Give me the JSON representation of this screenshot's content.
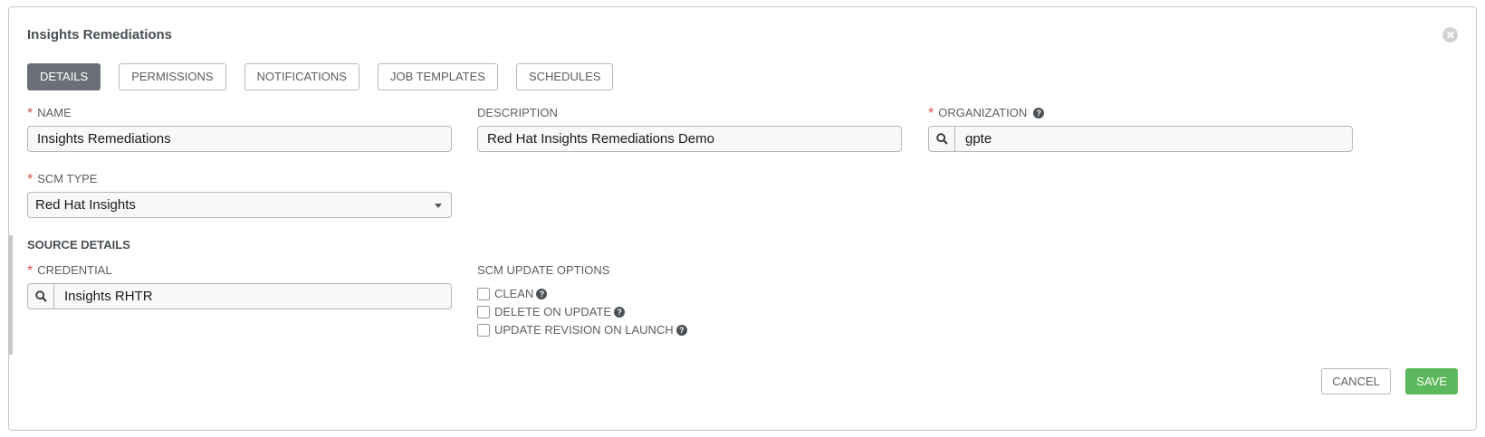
{
  "dialog": {
    "title": "Insights Remediations"
  },
  "tabs": [
    {
      "label": "DETAILS",
      "active": true
    },
    {
      "label": "PERMISSIONS"
    },
    {
      "label": "NOTIFICATIONS"
    },
    {
      "label": "JOB TEMPLATES"
    },
    {
      "label": "SCHEDULES"
    }
  ],
  "form": {
    "name": {
      "label": "NAME",
      "required": "*",
      "value": "Insights Remediations"
    },
    "description": {
      "label": "DESCRIPTION",
      "value": "Red Hat Insights Remediations Demo"
    },
    "organization": {
      "label": "ORGANIZATION",
      "required": "*",
      "help": "?",
      "value": "gpte"
    },
    "scm_type": {
      "label": "SCM TYPE",
      "required": "*",
      "value": "Red Hat Insights"
    },
    "source_details": {
      "heading": "SOURCE DETAILS",
      "credential": {
        "label": "CREDENTIAL",
        "required": "*",
        "value": "Insights RHTR"
      },
      "scm_update_options": {
        "label": "SCM UPDATE OPTIONS",
        "options": [
          {
            "label": "CLEAN",
            "help": "?",
            "checked": false
          },
          {
            "label": "DELETE ON UPDATE",
            "help": "?",
            "checked": false
          },
          {
            "label": "UPDATE REVISION ON LAUNCH",
            "help": "?",
            "checked": false
          }
        ]
      }
    }
  },
  "actions": {
    "cancel": "CANCEL",
    "save": "SAVE"
  },
  "colors": {
    "save": "#5cb85c",
    "active_tab": "#6b7078",
    "required": "#d9534f"
  },
  "icons": {
    "close": "close-icon",
    "search": "search-icon",
    "help": "help-icon",
    "caret": "caret-down-icon"
  }
}
